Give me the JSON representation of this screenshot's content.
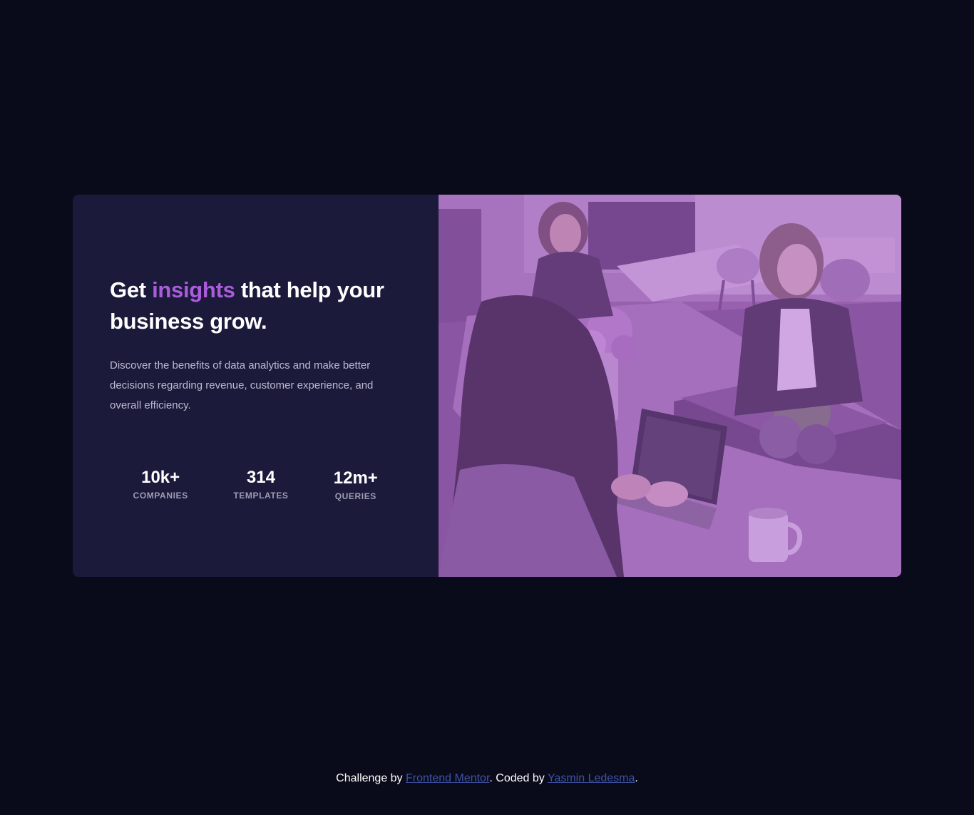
{
  "card": {
    "headline": {
      "before": "Get ",
      "accent": "insights",
      "after": " that help your business grow."
    },
    "description": "Discover the benefits of data analytics and make better decisions regarding revenue, customer experience, and overall efficiency.",
    "stats": [
      {
        "value": "10k+",
        "label": "COMPANIES"
      },
      {
        "value": "314",
        "label": "TEMPLATES"
      },
      {
        "value": "12m+",
        "label": "QUERIES"
      }
    ],
    "image_icon": "office-photo"
  },
  "footer": {
    "prefix": "Challenge by ",
    "link1": "Frontend Mentor",
    "middle": ". Coded by ",
    "link2": "Yasmin Ledesma",
    "suffix": "."
  },
  "colors": {
    "page_bg": "#090b1a",
    "card_bg": "#1b1a3b",
    "accent": "#ab5cdb",
    "link": "#3e52a3",
    "image_tint": "#8d5f9a"
  }
}
